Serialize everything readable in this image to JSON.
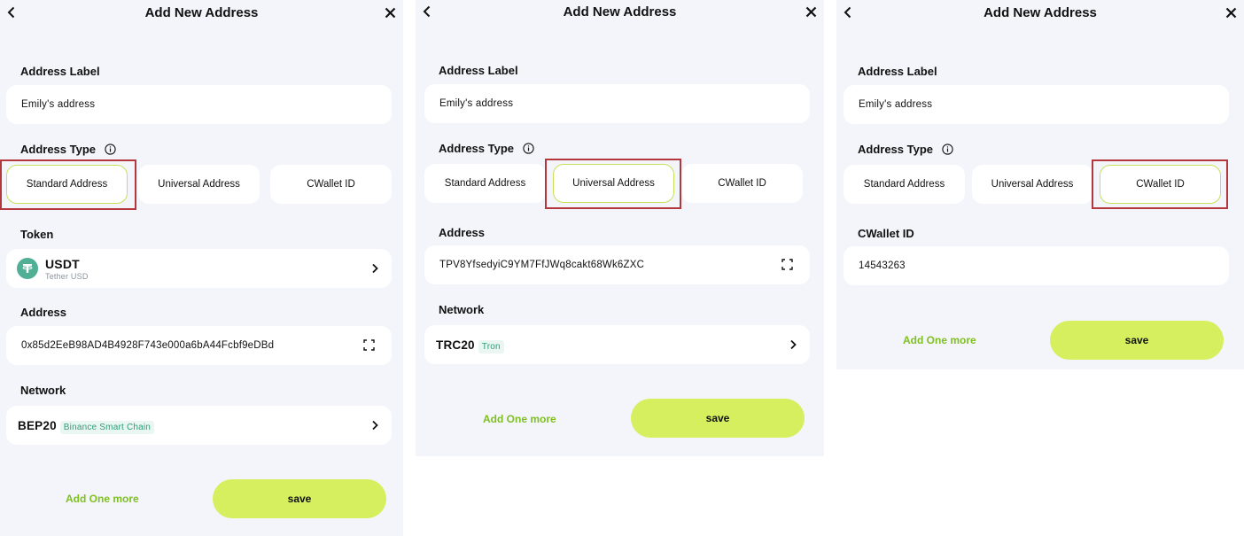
{
  "header": {
    "title": "Add New Address"
  },
  "labels": {
    "address_label": "Address Label",
    "address_type": "Address Type",
    "token": "Token",
    "address": "Address",
    "network": "Network",
    "cwallet_id": "CWallet ID"
  },
  "types": [
    "Standard Address",
    "Universal Address",
    "CWallet ID"
  ],
  "buttons": {
    "add_more": "Add One more",
    "save": "save"
  },
  "panel1": {
    "label_value": "Emily's address",
    "selected_type": "Standard Address",
    "token": {
      "symbol": "USDT",
      "name": "Tether USD",
      "icon": "tether-icon",
      "color": "#50af95"
    },
    "address_value": "0x85d2EeB98AD4B4928F743e000a6bA44Fcbf9eDBd",
    "network": {
      "name": "BEP20",
      "chain": "Binance Smart Chain"
    }
  },
  "panel2": {
    "label_value": "Emily's address",
    "selected_type": "Universal Address",
    "address_value": "TPV8YfsedyiC9YM7FfJWq8cakt68Wk6ZXC",
    "network": {
      "name": "TRC20",
      "chain": "Tron"
    }
  },
  "panel3": {
    "label_value": "Emily's address",
    "selected_type": "CWallet ID",
    "cwallet_id_value": "14543263"
  },
  "colors": {
    "accent": "#d5ef5f",
    "accent_text": "#7fbf1f",
    "highlight": "#b3373d",
    "background": "#f3f5fb"
  }
}
